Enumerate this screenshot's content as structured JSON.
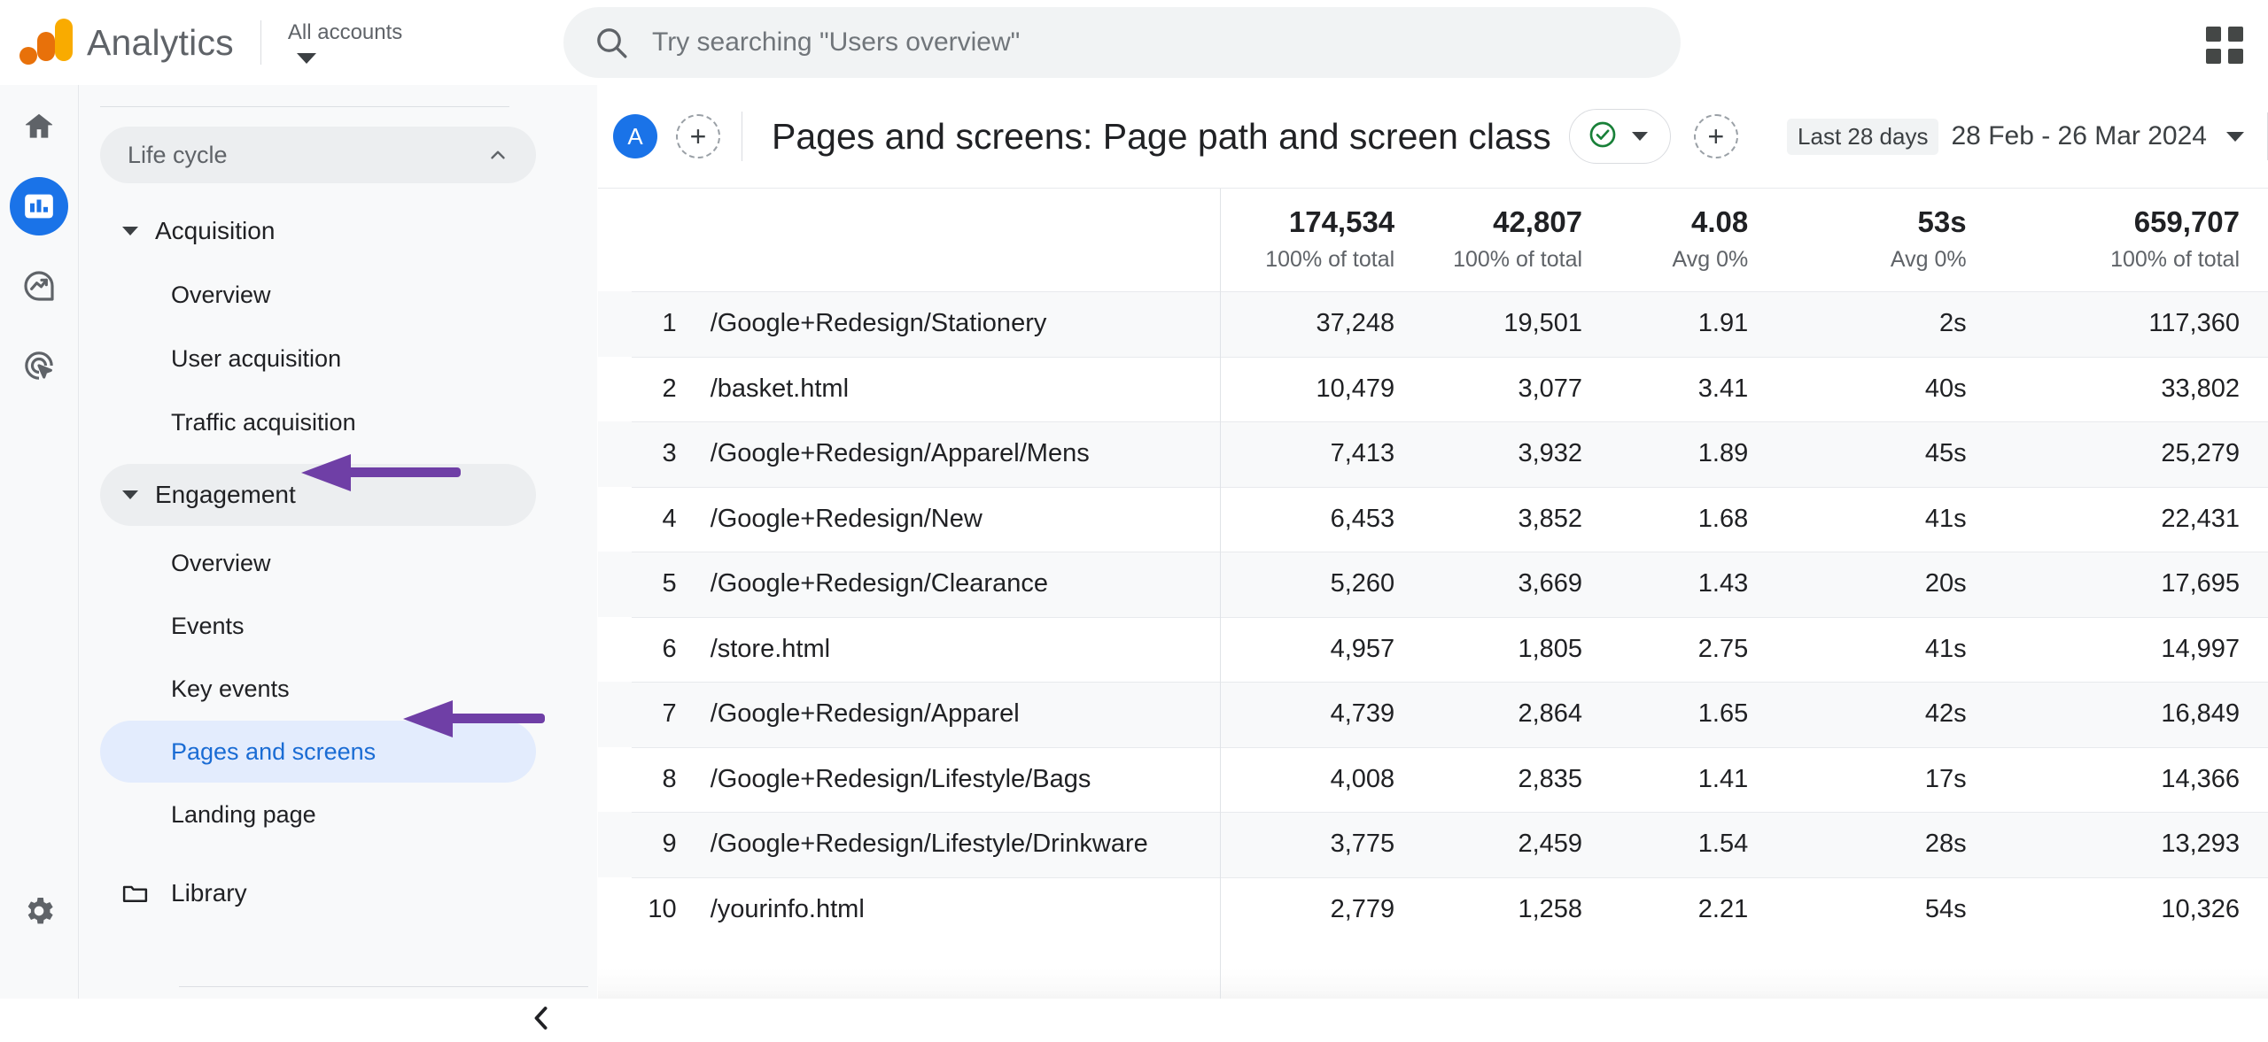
{
  "topbar": {
    "logo_icon": "google-analytics-logo",
    "brand": "Analytics",
    "account_selector": "All accounts",
    "search": {
      "icon": "search-icon",
      "placeholder": "Try searching \"Users overview\"",
      "value": ""
    },
    "apps_icon": "google-apps-grid-icon"
  },
  "rail": {
    "items": [
      {
        "name": "home-icon",
        "label": "Home",
        "selected": false
      },
      {
        "name": "reports-bar-chart-icon",
        "label": "Reports",
        "selected": true
      },
      {
        "name": "explore-trending-icon",
        "label": "Explore",
        "selected": false
      },
      {
        "name": "advertising-target-icon",
        "label": "Advertising",
        "selected": false
      }
    ],
    "settings": {
      "name": "gear-icon",
      "label": "Admin"
    }
  },
  "sidebar": {
    "section": {
      "label": "Life cycle",
      "collapse_icon": "chevron-up-icon"
    },
    "groups": [
      {
        "label": "Acquisition",
        "expanded": true,
        "items": [
          "Overview",
          "User acquisition",
          "Traffic acquisition"
        ]
      },
      {
        "label": "Engagement",
        "expanded": true,
        "highlighted": true,
        "items": [
          "Overview",
          "Events",
          "Key events",
          "Pages and screens",
          "Landing page"
        ]
      }
    ],
    "library": {
      "label": "Library",
      "icon": "folder-icon"
    },
    "collapse_button": "chevron-left-icon",
    "active_item": "Pages and screens",
    "annotation_color": "#6f3fa6"
  },
  "main": {
    "avatar_initial": "A",
    "add_comparison_icon": "add-circle-dashed-icon",
    "title": "Pages and screens: Page path and screen class",
    "comparison_chip": {
      "status_icon": "check-circle-icon",
      "status_color": "#188038",
      "caret_icon": "chevron-down-icon"
    },
    "add_segment_icon": "add-circle-dashed-icon",
    "date_range": {
      "preset": "Last 28 days",
      "range": "28 Feb - 26 Mar 2024",
      "caret_icon": "chevron-down-icon"
    }
  },
  "table": {
    "totals": [
      {
        "value": "174,534",
        "sub": "100% of total"
      },
      {
        "value": "42,807",
        "sub": "100% of total"
      },
      {
        "value": "4.08",
        "sub": "Avg 0%"
      },
      {
        "value": "53s",
        "sub": "Avg 0%"
      },
      {
        "value": "659,707",
        "sub": "100% of total"
      }
    ],
    "rows": [
      {
        "rank": "1",
        "path": "/Google+Redesign/Stationery",
        "m": [
          "37,248",
          "19,501",
          "1.91",
          "2s",
          "117,360"
        ]
      },
      {
        "rank": "2",
        "path": "/basket.html",
        "m": [
          "10,479",
          "3,077",
          "3.41",
          "40s",
          "33,802"
        ]
      },
      {
        "rank": "3",
        "path": "/Google+Redesign/Apparel/Mens",
        "m": [
          "7,413",
          "3,932",
          "1.89",
          "45s",
          "25,279"
        ]
      },
      {
        "rank": "4",
        "path": "/Google+Redesign/New",
        "m": [
          "6,453",
          "3,852",
          "1.68",
          "41s",
          "22,431"
        ]
      },
      {
        "rank": "5",
        "path": "/Google+Redesign/Clearance",
        "m": [
          "5,260",
          "3,669",
          "1.43",
          "20s",
          "17,695"
        ]
      },
      {
        "rank": "6",
        "path": "/store.html",
        "m": [
          "4,957",
          "1,805",
          "2.75",
          "41s",
          "14,997"
        ]
      },
      {
        "rank": "7",
        "path": "/Google+Redesign/Apparel",
        "m": [
          "4,739",
          "2,864",
          "1.65",
          "42s",
          "16,849"
        ]
      },
      {
        "rank": "8",
        "path": "/Google+Redesign/Lifestyle/Bags",
        "m": [
          "4,008",
          "2,835",
          "1.41",
          "17s",
          "14,366"
        ]
      },
      {
        "rank": "9",
        "path": "/Google+Redesign/Lifestyle/Drinkware",
        "m": [
          "3,775",
          "2,459",
          "1.54",
          "28s",
          "13,293"
        ]
      },
      {
        "rank": "10",
        "path": "/yourinfo.html",
        "m": [
          "2,779",
          "1,258",
          "2.21",
          "54s",
          "10,326"
        ]
      }
    ]
  }
}
